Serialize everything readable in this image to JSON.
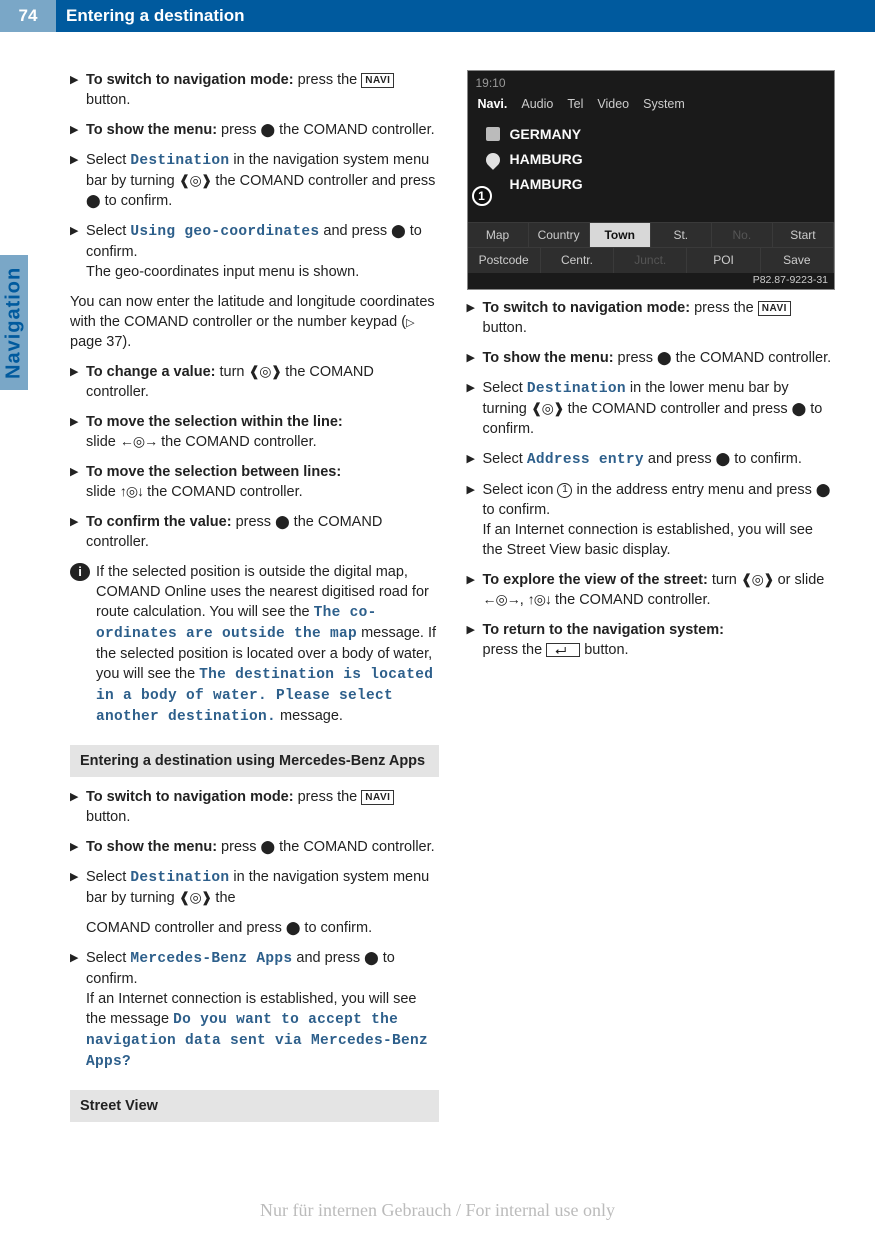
{
  "header": {
    "page_number": "74",
    "title": "Entering a destination"
  },
  "side_tab": "Navigation",
  "icons": {
    "press": "⬤",
    "turn_brackets_left": "❰",
    "turn_brackets_right": "❱",
    "ring": "◎",
    "slide_h": "↔",
    "slide_v": "↕",
    "up": "↑",
    "down": "↓",
    "left": "←",
    "right": "→"
  },
  "keys": {
    "navi": "NAVI"
  },
  "left_column": {
    "s1": {
      "bold": "To switch to navigation mode:",
      "rest1": " press the ",
      "rest2": " button."
    },
    "s2": {
      "bold": "To show the menu:",
      "rest1": " press ",
      "rest2": " the COMAND controller."
    },
    "s3": {
      "pre": "Select ",
      "ui": "Destination",
      "rest": " in the navigation system menu bar by turning ",
      "rest2": " the COMAND controller and press ",
      "rest3": " to confirm."
    },
    "s4": {
      "pre": "Select ",
      "ui": "Using geo-coordinates",
      "mid": " and press ",
      "end": " to confirm.",
      "result": "The geo-coordinates input menu is shown."
    },
    "p1": "You can now enter the latitude and longitude coordinates with the COMAND controller or the number keypad (",
    "p1_ref": "page 37",
    "p1_end": ").",
    "s5": {
      "bold": "To change a value:",
      "rest1": " turn ",
      "rest2": " the COMAND controller."
    },
    "s6": {
      "bold": "To move the selection within the line:",
      "rest1": "slide ",
      "rest2": " the COMAND controller."
    },
    "s7": {
      "bold": "To move the selection between lines:",
      "rest1": "slide ",
      "rest2": " the COMAND controller."
    },
    "s8": {
      "bold": "To confirm the value:",
      "rest1": " press ",
      "rest2": " the COMAND controller."
    },
    "note": {
      "pre": "If the selected position is outside the digital map, COMAND Online uses the nearest digitised road for route calculation. You will see the ",
      "ui1": "The co-ordinates are outside the map",
      "mid": " message. If the selected position is located over a body of water, you will see the ",
      "ui2": "The destination is located in a body of water. Please select another destination.",
      "end": " message."
    },
    "heading1": "Entering a destination using Mercedes-Benz Apps",
    "m1": {
      "bold": "To switch to navigation mode:",
      "rest1": " press the ",
      "rest2": " button."
    },
    "m2": {
      "bold": "To show the menu:",
      "rest1": " press ",
      "rest2": " the COMAND controller."
    },
    "m3": {
      "pre": "Select ",
      "ui": "Destination",
      "rest": " in the navigation system menu bar by turning ",
      "rest2": " the "
    }
  },
  "right_column": {
    "cont": {
      "pre": "COMAND controller and press ",
      "end": " to confirm."
    },
    "m4": {
      "pre": "Select ",
      "ui": "Mercedes-Benz Apps",
      "mid": " and press ",
      "end": " to confirm.",
      "result_pre": "If an Internet connection is established, you will see the message ",
      "result_ui": "Do you want to accept the navigation data sent via Mercedes-Benz Apps?"
    },
    "heading2": "Street View",
    "screenshot": {
      "time": "19:10",
      "tabs": [
        "Navi.",
        "Audio",
        "Tel",
        "Video",
        "System"
      ],
      "loc_country_flag": "🏳",
      "loc_country": "GERMANY",
      "loc_city_icon": "📍",
      "loc_city": "HAMBURG",
      "loc_town": "HAMBURG",
      "marker": "1",
      "menu_top": [
        "Map",
        "Country",
        "Town",
        "St.",
        "No.",
        "Start"
      ],
      "menu_top_selected_index": 2,
      "menu_bottom": [
        "Postcode",
        "Centr.",
        "Junct.",
        "POI",
        "Save"
      ],
      "caption": "P82.87-9223-31"
    },
    "sv1": {
      "bold": "To switch to navigation mode:",
      "rest1": " press the ",
      "rest2": " button."
    },
    "sv2": {
      "bold": "To show the menu:",
      "rest1": " press ",
      "rest2": " the COMAND controller."
    },
    "sv3": {
      "pre": "Select ",
      "ui": "Destination",
      "rest": " in the lower menu bar by turning ",
      "rest2": " the COMAND controller and press ",
      "rest3": " to confirm."
    },
    "sv4": {
      "pre": "Select ",
      "ui": "Address entry",
      "mid": " and press ",
      "end": " to confirm."
    },
    "sv5": {
      "pre": "Select icon ",
      "num": "1",
      "mid": " in the address entry menu and press ",
      "end": " to confirm.",
      "result": "If an Internet connection is established, you will see the Street View basic display."
    },
    "sv6": {
      "bold": "To explore the view of the street:",
      "rest1": " turn ",
      "mid": " or slide ",
      "end": " the COMAND controller."
    },
    "sv7": {
      "bold": "To return to the navigation system:",
      "rest1": "press the ",
      "rest2": " button."
    }
  },
  "watermark": "Nur für internen Gebrauch / For internal use only"
}
